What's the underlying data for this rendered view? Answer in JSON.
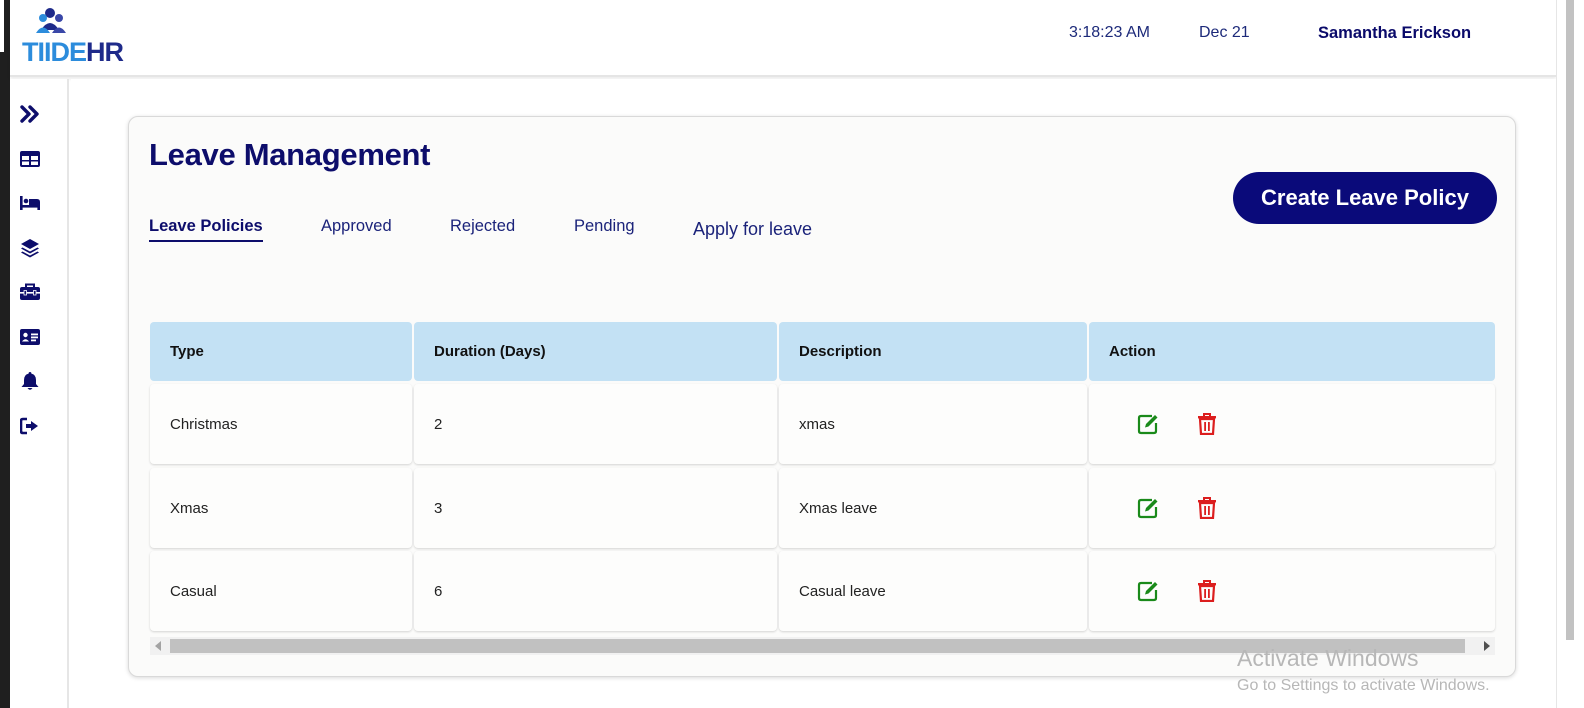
{
  "brand": {
    "logo_part1": "TIIDE",
    "logo_part2": "HR"
  },
  "header": {
    "clock": "3:18:23 AM",
    "date": "Dec 21",
    "user_name": "Samantha Erickson"
  },
  "sidebar": {
    "items": [
      {
        "icon": "double-chevron-right-icon"
      },
      {
        "icon": "table-icon"
      },
      {
        "icon": "bed-icon"
      },
      {
        "icon": "layers-icon"
      },
      {
        "icon": "toolbox-icon"
      },
      {
        "icon": "id-card-icon"
      },
      {
        "icon": "bell-icon"
      },
      {
        "icon": "sign-out-icon"
      }
    ]
  },
  "page": {
    "title": "Leave Management",
    "create_button": "Create Leave Policy",
    "tabs": [
      "Leave Policies",
      "Approved",
      "Rejected",
      "Pending",
      "Apply for leave"
    ],
    "active_tab": "Leave Policies"
  },
  "table": {
    "columns": [
      "Type",
      "Duration (Days)",
      "Description",
      "Action"
    ],
    "rows": [
      {
        "type": "Christmas",
        "duration": "2",
        "description": "xmas"
      },
      {
        "type": "Xmas",
        "duration": "3",
        "description": "Xmas leave"
      },
      {
        "type": "Casual",
        "duration": "6",
        "description": "Casual leave"
      }
    ],
    "action_icons": {
      "edit": "edit-icon",
      "delete": "trash-icon",
      "edit_color": "#1a8a1a",
      "delete_color": "#dc1e1e"
    }
  },
  "theme": {
    "primary": "#0a0a7a",
    "header_cell": "#c3e1f4"
  },
  "watermark": {
    "title": "Activate Windows",
    "subtitle": "Go to Settings to activate Windows."
  }
}
